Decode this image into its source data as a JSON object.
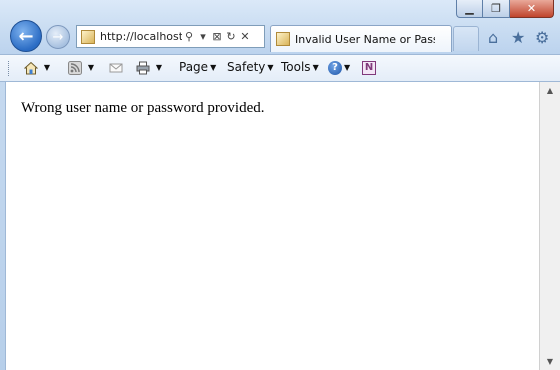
{
  "window": {
    "minimize_glyph": "▁",
    "maximize_glyph": "❐",
    "close_glyph": "✕"
  },
  "nav": {
    "back_glyph": "←",
    "forward_glyph": "→",
    "address_url": "http://localhost:",
    "search_glyph": "⚲",
    "dropdown_glyph": "▾",
    "compat_glyph": "⊠",
    "refresh_glyph": "↻",
    "stop_glyph": "✕"
  },
  "tab": {
    "title": "Invalid User Name or Pass..."
  },
  "right_icons": {
    "home_glyph": "⌂",
    "favorites_glyph": "★",
    "tools_glyph": "⚙"
  },
  "command_bar": {
    "page_label": "Page",
    "safety_label": "Safety",
    "tools_label": "Tools",
    "help_glyph": "?",
    "onenote_glyph": "N",
    "arrow": "▼"
  },
  "content": {
    "message": "Wrong user name or password provided."
  },
  "scrollbar": {
    "up_glyph": "▲",
    "down_glyph": "▼"
  }
}
